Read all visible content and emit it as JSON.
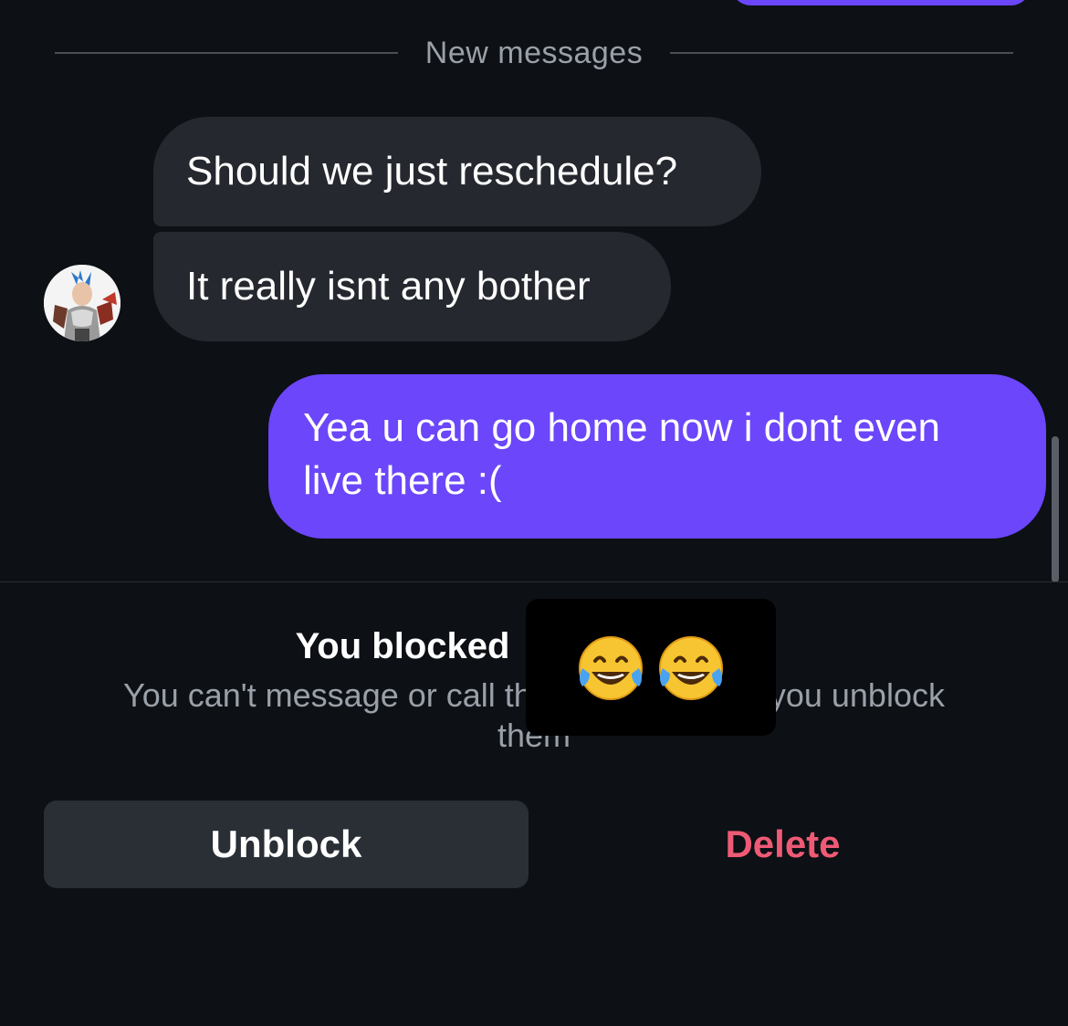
{
  "divider": {
    "label": "New messages"
  },
  "messages": [
    {
      "direction": "incoming",
      "text": "Should we just reschedule?"
    },
    {
      "direction": "incoming",
      "text": "It really isnt any bother"
    },
    {
      "direction": "outgoing",
      "text": "Yea u can go home now i dont even live there :("
    }
  ],
  "blocked_panel": {
    "title": "You blocked",
    "description": "You can't message or call th",
    "description_end": "you unblock",
    "description_line2": "them",
    "redaction_emoji": [
      "face-with-tears-of-joy",
      "face-with-tears-of-joy"
    ]
  },
  "actions": {
    "unblock_label": "Unblock",
    "delete_label": "Delete"
  },
  "colors": {
    "background": "#0d1015",
    "incoming_bubble": "#25282e",
    "outgoing_bubble": "#6b46fa",
    "delete_text": "#ee5a75",
    "secondary_text": "#9aa0a8"
  }
}
